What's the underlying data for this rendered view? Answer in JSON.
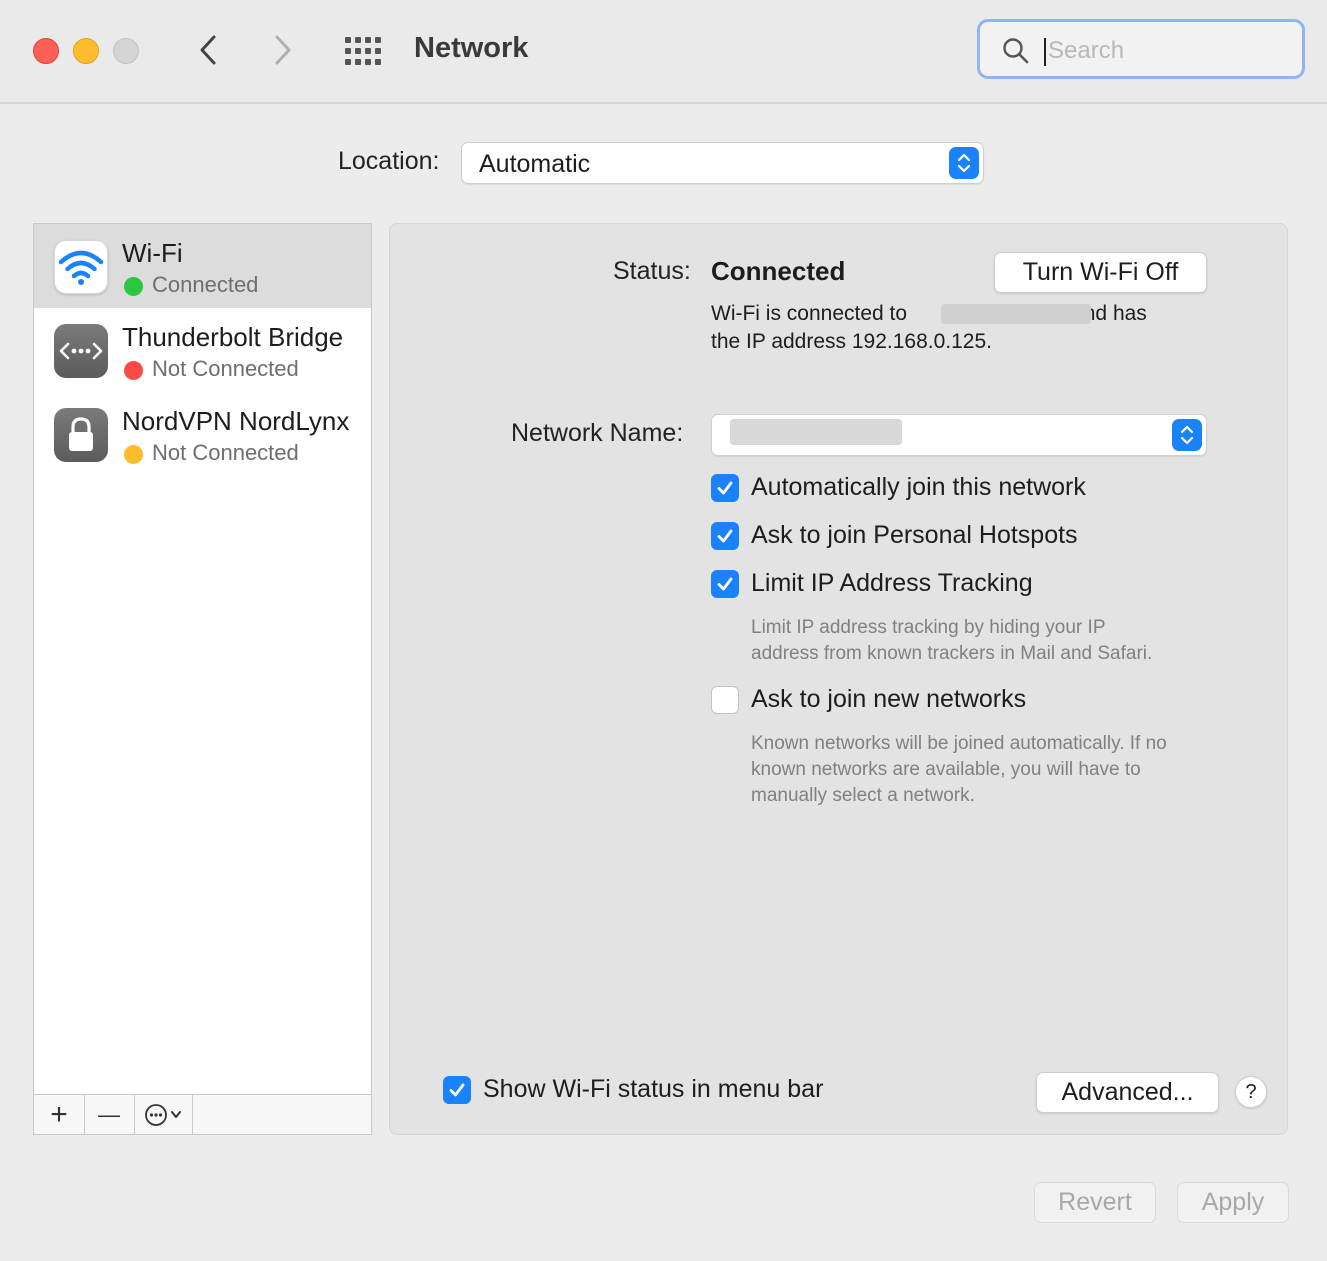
{
  "window": {
    "title": "Network",
    "search_placeholder": "Search",
    "back_icon": "chevron-left-icon",
    "forward_icon": "chevron-right-icon",
    "grid_icon": "grid-icon"
  },
  "location": {
    "label": "Location:",
    "value": "Automatic"
  },
  "services": [
    {
      "name": "Wi-Fi",
      "status": "Connected",
      "status_color": "#2ac840",
      "icon": "wifi-icon",
      "selected": true
    },
    {
      "name": "Thunderbolt Bridge",
      "status": "Not Connected",
      "status_color": "#fe4a44",
      "icon": "thunderbolt-bridge-icon",
      "selected": false
    },
    {
      "name": "NordVPN NordLynx",
      "status": "Not Connected",
      "status_color": "#fdbc2c",
      "icon": "lock-icon",
      "selected": false
    }
  ],
  "sidebar_toolbar": {
    "add": "+",
    "remove": "—",
    "more_icon": "ellipsis-circle-icon"
  },
  "detail": {
    "status_label": "Status:",
    "status_value": "Connected",
    "turn_off_button": "Turn Wi-Fi Off",
    "desc_line1_pre": "Wi-Fi is connected to",
    "desc_line1_post": "and has",
    "desc_line2": "the IP address 192.168.0.125.",
    "network_name_label": "Network Name:",
    "options": [
      {
        "label": "Automatically join this network",
        "checked": true
      },
      {
        "label": "Ask to join Personal Hotspots",
        "checked": true
      },
      {
        "label": "Limit IP Address Tracking",
        "checked": true
      },
      {
        "label": "Ask to join new networks",
        "checked": false
      }
    ],
    "limit_help": [
      "Limit IP address tracking by hiding your IP",
      "address from known trackers in Mail and Safari."
    ],
    "new_networks_help": [
      "Known networks will be joined automatically. If no",
      "known networks are available, you will have to",
      "manually select a network."
    ],
    "show_status": {
      "label": "Show Wi-Fi status in menu bar",
      "checked": true
    },
    "advanced_button": "Advanced...",
    "help_button": "?"
  },
  "footer": {
    "revert_button": "Revert",
    "apply_button": "Apply"
  },
  "colors": {
    "accent": "#1a82fb",
    "connected": "#2ac840",
    "not_connected_red": "#fe4a44",
    "not_connected_yellow": "#fdbc2c"
  }
}
